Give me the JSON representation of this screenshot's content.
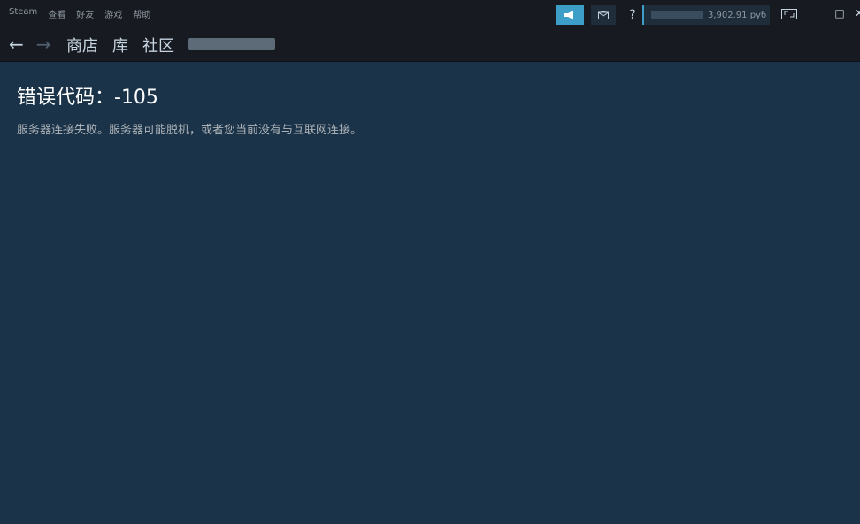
{
  "menu": {
    "items": [
      "Steam",
      "查看",
      "好友",
      "游戏",
      "帮助"
    ]
  },
  "titlebar": {
    "broadcast_icon": "megaphone-icon",
    "mail_icon": "envelope-icon",
    "help_label": "?",
    "balance": "3,902.91 руб",
    "bigpicture_icon": "big-picture-icon",
    "minimize": "_",
    "maximize": "□",
    "close": "✕"
  },
  "nav": {
    "back": "←",
    "forward": "→",
    "links": [
      "商店",
      "库",
      "社区"
    ]
  },
  "error": {
    "title": "错误代码：-105",
    "message": "服务器连接失败。服务器可能脱机，或者您当前没有与互联网连接。"
  },
  "colors": {
    "background": "#1b3348",
    "bar": "#171a21",
    "accent": "#3d9ec8"
  }
}
